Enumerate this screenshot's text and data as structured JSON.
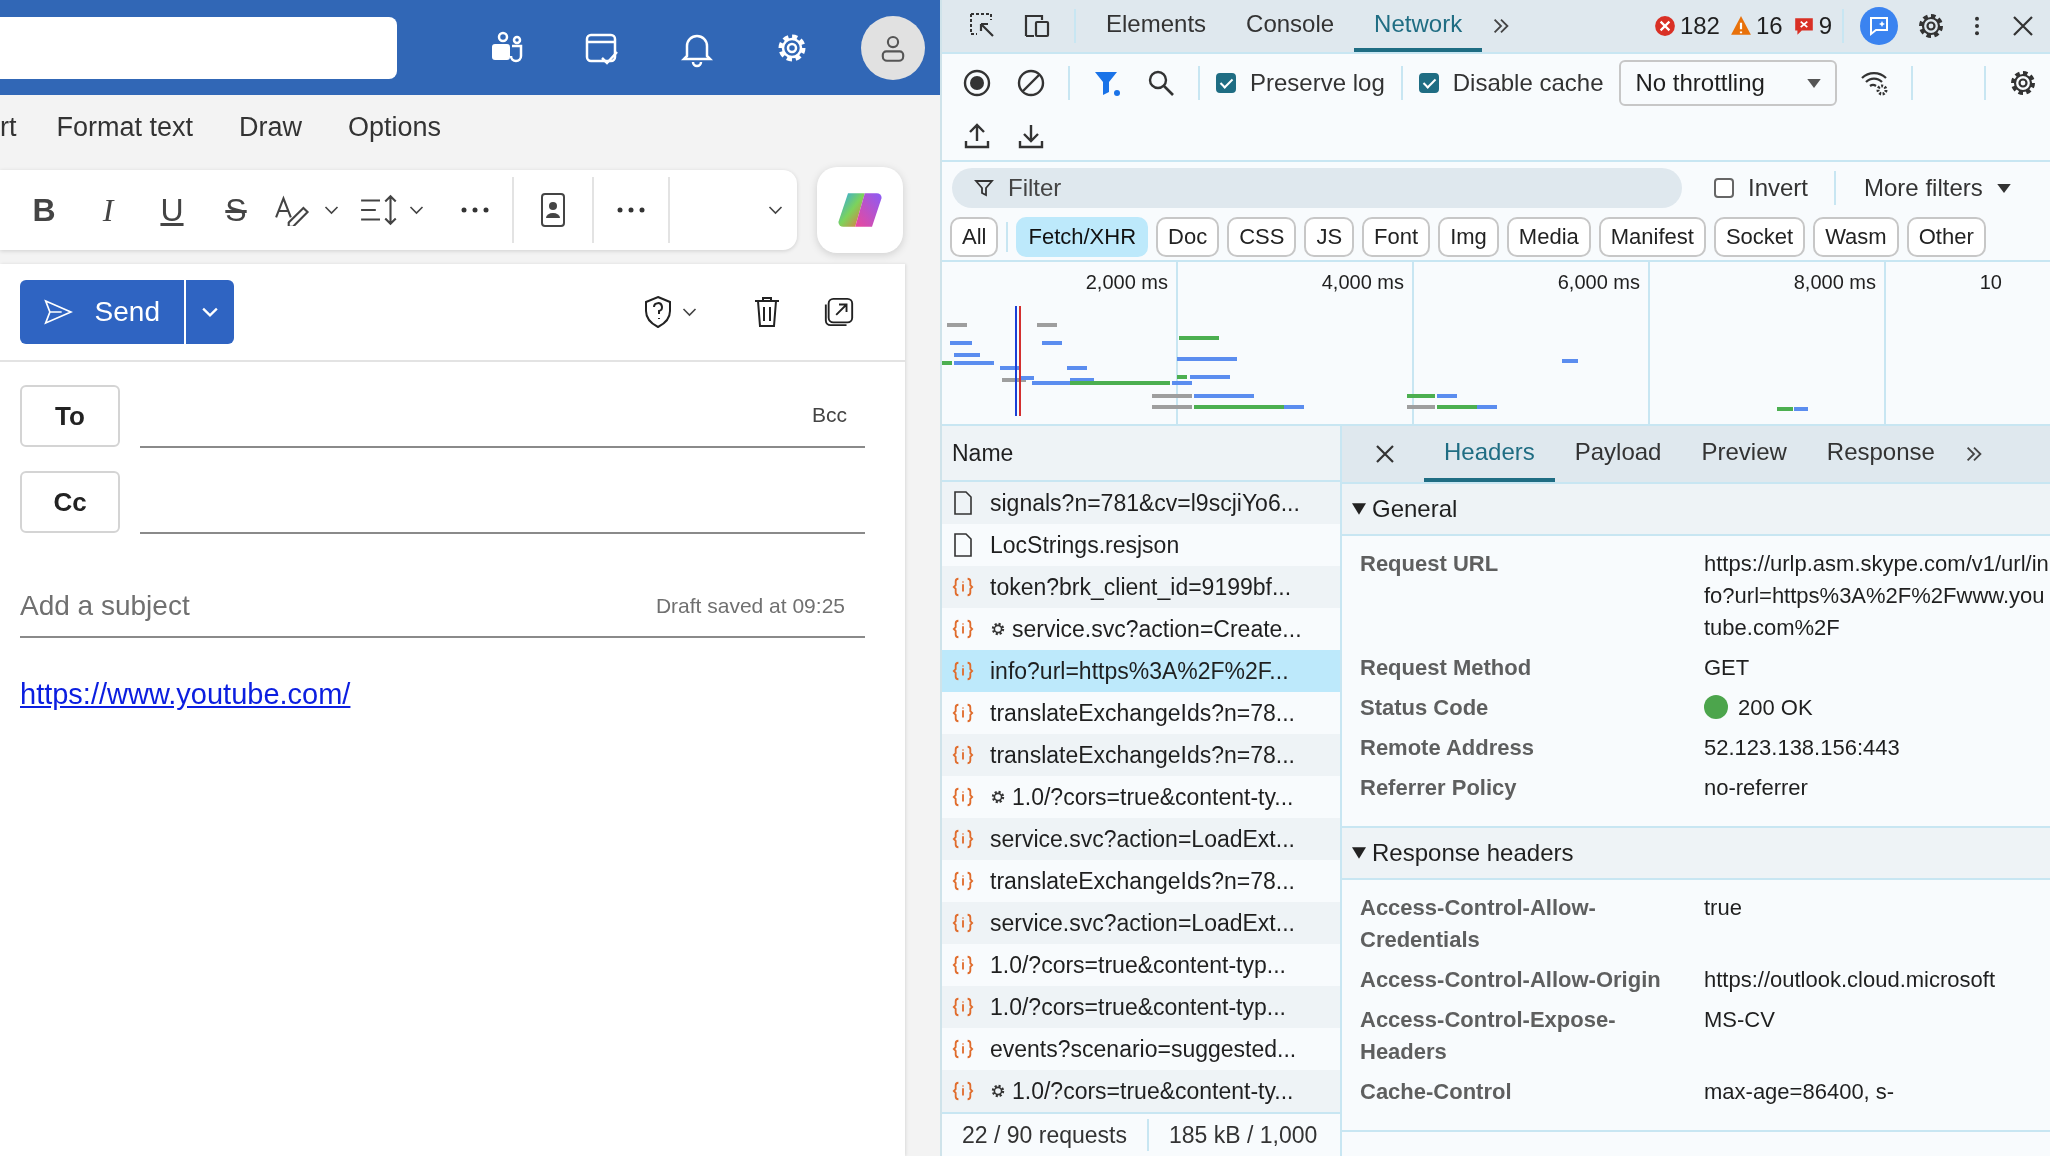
{
  "mail": {
    "ribbon_tabs": [
      "rt",
      "Format text",
      "Draw",
      "Options"
    ],
    "format_buttons": [
      {
        "label": "B",
        "kind": "bold"
      },
      {
        "label": "I",
        "kind": "italic"
      },
      {
        "label": "U",
        "kind": "underline"
      },
      {
        "label": "S",
        "kind": "strike"
      }
    ],
    "send": "Send",
    "to": "To",
    "cc": "Cc",
    "bcc": "Bcc",
    "subject": {
      "placeholder": "Add a subject"
    },
    "draft_status": "Draft saved at 09:25",
    "body_link": "https://www.youtube.com/"
  },
  "devtools": {
    "tabs": [
      {
        "label": "Elements",
        "selected": false
      },
      {
        "label": "Console",
        "selected": false
      },
      {
        "label": "Network",
        "selected": true
      }
    ],
    "errors": "182",
    "warnings": "16",
    "issues": "9",
    "preserve_log": {
      "label": "Preserve log",
      "checked": true
    },
    "disable_cache": {
      "label": "Disable cache",
      "checked": true
    },
    "throttling": "No throttling",
    "filter": {
      "placeholder": "Filter"
    },
    "invert": {
      "label": "Invert",
      "checked": false
    },
    "more_filters": "More filters",
    "types": [
      {
        "label": "All",
        "selected": false
      },
      {
        "label": "Fetch/XHR",
        "selected": true
      },
      {
        "label": "Doc",
        "selected": false
      },
      {
        "label": "CSS",
        "selected": false
      },
      {
        "label": "JS",
        "selected": false
      },
      {
        "label": "Font",
        "selected": false
      },
      {
        "label": "Img",
        "selected": false
      },
      {
        "label": "Media",
        "selected": false
      },
      {
        "label": "Manifest",
        "selected": false
      },
      {
        "label": "Socket",
        "selected": false
      },
      {
        "label": "Wasm",
        "selected": false
      },
      {
        "label": "Other",
        "selected": false
      }
    ],
    "timeline_ticks": [
      "2,000 ms",
      "4,000 ms",
      "6,000 ms",
      "8,000 ms",
      "10"
    ],
    "name_header": "Name",
    "requests": [
      {
        "name": "signals?n=781&cv=l9scjiYo6...",
        "kind": "doc",
        "throttled": false,
        "selected": false
      },
      {
        "name": "LocStrings.resjson",
        "kind": "doc",
        "throttled": false,
        "selected": false
      },
      {
        "name": "token?brk_client_id=9199bf...",
        "kind": "xhr",
        "throttled": false,
        "selected": false
      },
      {
        "name": "service.svc?action=Create...",
        "kind": "xhr",
        "throttled": true,
        "selected": false
      },
      {
        "name": "info?url=https%3A%2F%2F...",
        "kind": "xhr",
        "throttled": false,
        "selected": true
      },
      {
        "name": "translateExchangeIds?n=78...",
        "kind": "xhr",
        "throttled": false,
        "selected": false
      },
      {
        "name": "translateExchangeIds?n=78...",
        "kind": "xhr",
        "throttled": false,
        "selected": false
      },
      {
        "name": "1.0/?cors=true&content-ty...",
        "kind": "xhr",
        "throttled": true,
        "selected": false
      },
      {
        "name": "service.svc?action=LoadExt...",
        "kind": "xhr",
        "throttled": false,
        "selected": false
      },
      {
        "name": "translateExchangeIds?n=78...",
        "kind": "xhr",
        "throttled": false,
        "selected": false
      },
      {
        "name": "service.svc?action=LoadExt...",
        "kind": "xhr",
        "throttled": false,
        "selected": false
      },
      {
        "name": "1.0/?cors=true&content-typ...",
        "kind": "xhr",
        "throttled": false,
        "selected": false
      },
      {
        "name": "1.0/?cors=true&content-typ...",
        "kind": "xhr",
        "throttled": false,
        "selected": false
      },
      {
        "name": "events?scenario=suggested...",
        "kind": "xhr",
        "throttled": false,
        "selected": false
      },
      {
        "name": "1.0/?cors=true&content-ty...",
        "kind": "xhr",
        "throttled": true,
        "selected": false
      }
    ],
    "footer": [
      "22 / 90 requests",
      "185 kB / 1,000"
    ],
    "detail_tabs": [
      {
        "label": "Headers",
        "selected": true
      },
      {
        "label": "Payload",
        "selected": false
      },
      {
        "label": "Preview",
        "selected": false
      },
      {
        "label": "Response",
        "selected": false
      }
    ],
    "sections": [
      {
        "title": "General",
        "expanded": true,
        "rows": [
          {
            "label": "Request URL",
            "value": "https://urlp.asm.skype.com/v1/url/info?url=https%3A%2F%2Fwww.youtube.com%2F"
          },
          {
            "label": "Request Method",
            "value": "GET"
          },
          {
            "label": "Status Code",
            "value": "200 OK",
            "color": "#4ca54c"
          },
          {
            "label": "Remote Address",
            "value": "52.123.138.156:443"
          },
          {
            "label": "Referrer Policy",
            "value": "no-referrer"
          }
        ]
      },
      {
        "title": "Response headers",
        "expanded": true,
        "rows": [
          {
            "label": "Access-Control-Allow-Credentials",
            "value": "true"
          },
          {
            "label": "Access-Control-Allow-Origin",
            "value": "https://outlook.cloud.microsoft"
          },
          {
            "label": "Access-Control-Expose-Headers",
            "value": "MS-CV"
          },
          {
            "label": "Cache-Control",
            "value": "max-age=86400, s-"
          }
        ]
      }
    ]
  }
}
